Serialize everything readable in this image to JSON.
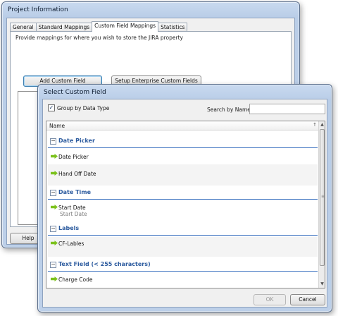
{
  "back_window": {
    "title": "Project Information",
    "tabs": [
      "General",
      "Standard Mappings",
      "Custom Field Mappings",
      "Statistics"
    ],
    "active_tab": "Custom Field Mappings",
    "description": "Provide mappings for where you wish to store the JIRA property",
    "add_button": "Add Custom Field",
    "setup_button": "Setup Enterprise Custom Fields",
    "help_button": "Help"
  },
  "dialog": {
    "title": "Select Custom Field",
    "group_checkbox_label": "Group by Data Type",
    "group_checked": true,
    "search_label": "Search by Name",
    "search_value": "",
    "column_header": "Name",
    "groups": [
      {
        "label": "Date Picker",
        "items": [
          {
            "name": "Date Picker"
          },
          {
            "name": "Hand Off Date"
          }
        ]
      },
      {
        "label": "Date Time",
        "items": [
          {
            "name": "Start Date",
            "sub": "Start Date"
          }
        ]
      },
      {
        "label": "Labels",
        "items": [
          {
            "name": "CF-Lables"
          }
        ]
      },
      {
        "label": "Text Field (< 255 characters)",
        "items": [
          {
            "name": "Charge Code"
          }
        ]
      }
    ],
    "ok_button": "OK",
    "cancel_button": "Cancel"
  },
  "icons": {
    "item_icon": "green-arrow-icon",
    "collapse_icon": "collapse-minus-icon",
    "check_icon": "checkmark-icon"
  },
  "colors": {
    "group_header_text": "#2b5a9e",
    "group_underline": "#3c72c0",
    "item_arrow": "#7cc21e"
  }
}
